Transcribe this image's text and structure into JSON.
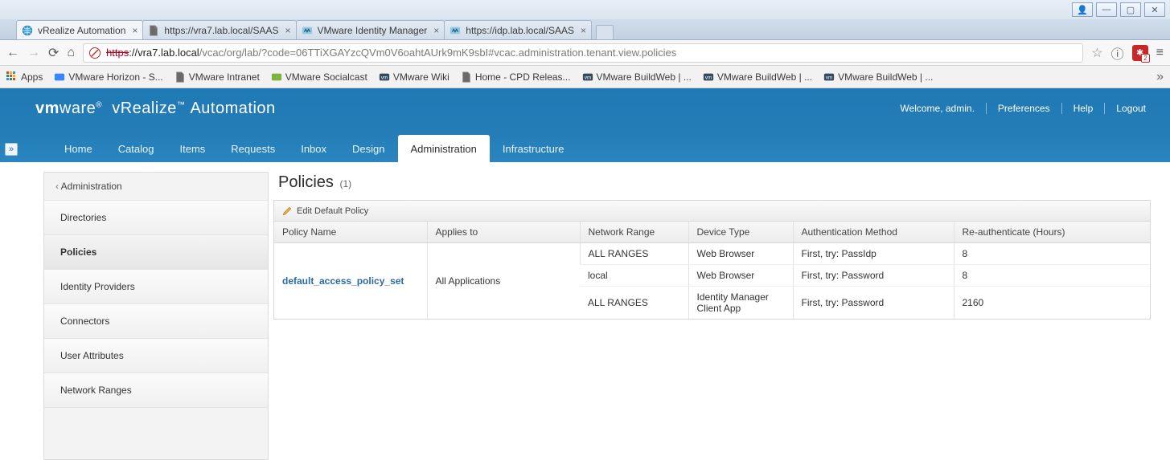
{
  "win": {
    "controls": [
      "user",
      "min",
      "max",
      "close"
    ]
  },
  "tabs": [
    {
      "label": "vRealize Automation",
      "fav": "globe",
      "active": true
    },
    {
      "label": "https://vra7.lab.local/SAAS",
      "fav": "doc",
      "active": false
    },
    {
      "label": "VMware Identity Manager",
      "fav": "vm",
      "active": false
    },
    {
      "label": "https://idp.lab.local/SAAS",
      "fav": "vm",
      "active": false
    }
  ],
  "address": {
    "scheme": "https",
    "host": "://vra7.lab.local",
    "path": "/vcac/org/lab/?code=06TTiXGAYzcQVm0V6oahtAUrk9mK9sbI#vcac.administration.tenant.view.policies"
  },
  "bookmarks": {
    "apps_label": "Apps",
    "items": [
      {
        "label": "VMware Horizon - S...",
        "icon": "vm-blue"
      },
      {
        "label": "VMware Intranet",
        "icon": "doc"
      },
      {
        "label": "VMware Socialcast",
        "icon": "vm-green"
      },
      {
        "label": "VMware Wiki",
        "icon": "vm-dark"
      },
      {
        "label": "Home - CPD Releas...",
        "icon": "doc"
      },
      {
        "label": "VMware BuildWeb | ...",
        "icon": "vm-dark"
      },
      {
        "label": "VMware BuildWeb | ...",
        "icon": "vm-dark"
      },
      {
        "label": "VMware BuildWeb | ...",
        "icon": "vm-dark"
      }
    ]
  },
  "brand": {
    "vm": "vmware",
    "reg": "®",
    "product1": "vRealize",
    "tm": "™",
    "product2": "Automation"
  },
  "header": {
    "welcome": "Welcome, admin.",
    "preferences": "Preferences",
    "help": "Help",
    "logout": "Logout"
  },
  "app_tabs": [
    "Home",
    "Catalog",
    "Items",
    "Requests",
    "Inbox",
    "Design",
    "Administration",
    "Infrastructure"
  ],
  "app_tabs_active": "Administration",
  "sidebar": {
    "head": "Administration",
    "items": [
      "Directories",
      "Policies",
      "Identity Providers",
      "Connectors",
      "User Attributes",
      "Network Ranges"
    ],
    "active": "Policies"
  },
  "page": {
    "title": "Policies",
    "count": "(1)",
    "action": "Edit Default Policy",
    "columns": [
      "Policy Name",
      "Applies to",
      "Network Range",
      "Device Type",
      "Authentication Method",
      "Re-authenticate (Hours)"
    ],
    "policy_name": "default_access_policy_set",
    "applies_to": "All Applications",
    "rows": [
      {
        "range": "ALL RANGES",
        "device": "Web Browser",
        "auth": "First, try: PassIdp",
        "reauth": "8"
      },
      {
        "range": "local",
        "device": "Web Browser",
        "auth": "First, try: Password",
        "reauth": "8"
      },
      {
        "range": "ALL RANGES",
        "device": "Identity Manager Client App",
        "auth": "First, try: Password",
        "reauth": "2160"
      }
    ]
  }
}
